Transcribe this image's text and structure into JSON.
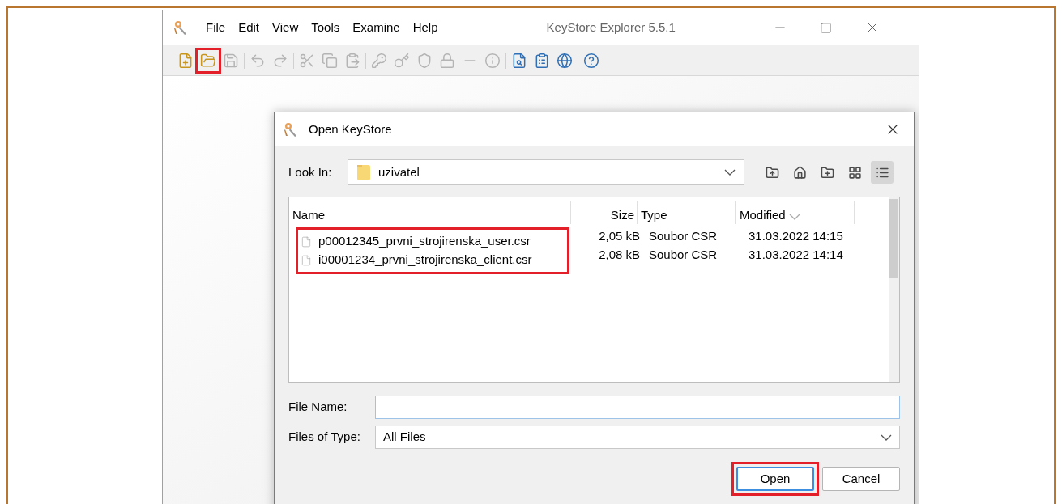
{
  "window": {
    "title": "KeyStore Explorer 5.5.1"
  },
  "menu": [
    "File",
    "Edit",
    "View",
    "Tools",
    "Examine",
    "Help"
  ],
  "toolbar": [
    {
      "tools": [
        {
          "disabled": false,
          "highlighted": false
        },
        {
          "disabled": false,
          "highlighted": true
        },
        {
          "disabled": true,
          "highlighted": false
        }
      ]
    },
    {
      "tools": [
        {
          "disabled": true,
          "highlighted": false
        },
        {
          "disabled": true,
          "highlighted": false
        }
      ]
    },
    {
      "tools": [
        {
          "disabled": true,
          "highlighted": false
        },
        {
          "disabled": true,
          "highlighted": false
        },
        {
          "disabled": true,
          "highlighted": false
        }
      ]
    },
    {
      "tools": [
        {
          "disabled": true,
          "highlighted": false
        },
        {
          "disabled": true,
          "highlighted": false
        },
        {
          "disabled": true,
          "highlighted": false
        },
        {
          "disabled": true,
          "highlighted": false
        },
        {
          "disabled": true,
          "highlighted": false
        },
        {
          "disabled": true,
          "highlighted": false
        }
      ]
    },
    {
      "tools": [
        {
          "disabled": false,
          "highlighted": false
        },
        {
          "disabled": false,
          "highlighted": false
        },
        {
          "disabled": false,
          "highlighted": false
        }
      ]
    },
    {
      "tools": [
        {
          "disabled": false,
          "highlighted": false
        }
      ]
    }
  ],
  "dialog": {
    "title": "Open KeyStore",
    "look_in": {
      "label": "Look In:",
      "value": "uzivatel"
    },
    "nav_buttons": [
      {
        "selected": false
      },
      {
        "selected": false
      },
      {
        "selected": false
      },
      {
        "selected": false
      },
      {
        "selected": true
      }
    ],
    "table": {
      "columns": [
        "Name",
        "Size",
        "Type",
        "Modified"
      ],
      "rows_highlighted": true,
      "rows": [
        {
          "name": "p00012345_prvni_strojirenska_user.csr",
          "size": "2,05 kB",
          "type": "Soubor CSR",
          "modified": "31.03.2022 14:15"
        },
        {
          "name": "i00001234_prvni_strojirenska_client.csr",
          "size": "2,08 kB",
          "type": "Soubor CSR",
          "modified": "31.03.2022 14:14"
        }
      ]
    },
    "file_name": {
      "label": "File Name:"
    },
    "files_of_type": {
      "label": "Files of Type:",
      "value": "All Files"
    },
    "buttons": [
      {
        "label": "Open",
        "highlighted": true
      },
      {
        "label": "Cancel",
        "highlighted": false
      }
    ]
  }
}
